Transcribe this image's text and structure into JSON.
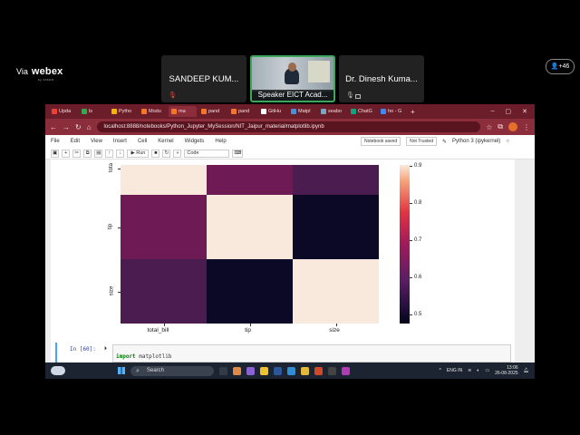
{
  "webex": {
    "via": "Via",
    "brand": "webex",
    "sub": "by CISCO",
    "participant_count": "+46"
  },
  "participants": [
    {
      "name": "SANDEEP KUM..."
    },
    {
      "name": "Speaker EICT Acad..."
    },
    {
      "name": "Dr. Dinesh Kuma..."
    }
  ],
  "browser": {
    "tabs": [
      "Upda",
      "ls",
      "Pytho",
      "Modu",
      "ma",
      "pand",
      "pand",
      "GitHu",
      "Matpl",
      "seabo",
      "ChatG",
      "ho - G"
    ],
    "url": "localhost:8888/notebooks/Python_Jupyter_MySession/NIT_Jaipur_material/matplotlib.ipynb"
  },
  "jupyter": {
    "menu": [
      "File",
      "Edit",
      "View",
      "Insert",
      "Cell",
      "Kernel",
      "Widgets",
      "Help"
    ],
    "notebook_saved": "Notebook saved",
    "trusted": "Not Trusted",
    "kernel": "Python 3 (ipykernel)",
    "run_label": "▶ Run",
    "cell_type": "Code",
    "prompt": "In [60]:",
    "code_keyword": "import",
    "code_rest": " matplotlib"
  },
  "heatmap": {
    "row_labels": [
      "total_bill",
      "tip",
      "size"
    ],
    "row_labels_display": [
      "tota",
      "tip",
      "size"
    ],
    "col_labels": [
      "total_bill",
      "tip",
      "size"
    ],
    "colorbar_ticks": [
      "0.9",
      "0.8",
      "0.7",
      "0.6",
      "0.5"
    ],
    "colors": [
      [
        "#f8e9dc",
        "#6e1a55",
        "#4b1c4f"
      ],
      [
        "#6e1a55",
        "#f8e9dc",
        "#0b0926"
      ],
      [
        "#4b1c4f",
        "#0b0926",
        "#f8e9dc"
      ]
    ]
  },
  "taskbar": {
    "search": "Search",
    "lang": "ENG IN",
    "time": "13:06",
    "date": "26-08-2025"
  }
}
